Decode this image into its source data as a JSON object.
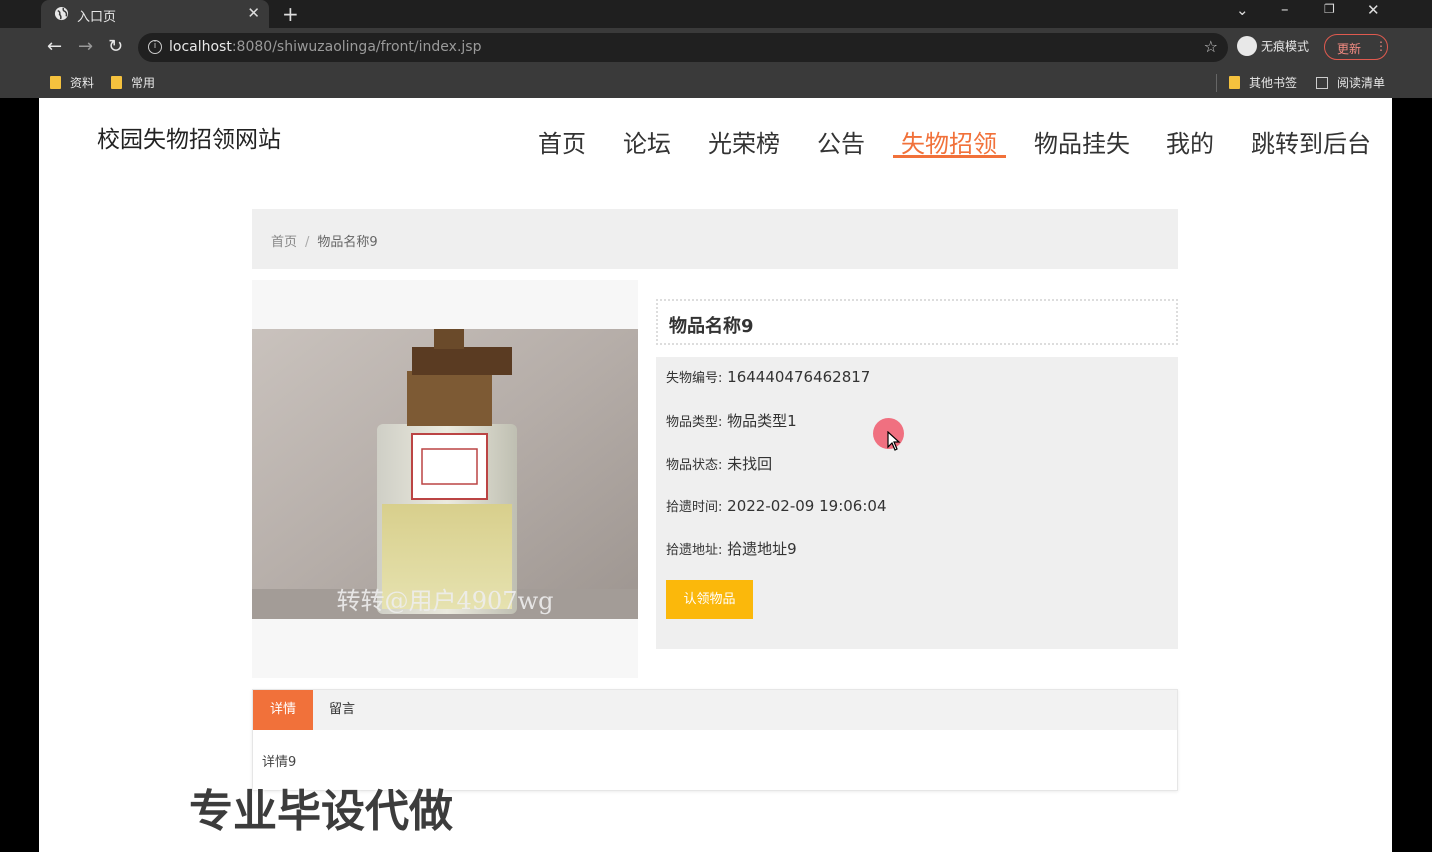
{
  "browser": {
    "tab_title": "入口页",
    "tab_close": "✕",
    "new_tab": "+",
    "url_host": "localhost",
    "url_rest": ":8080/shiwuzaolinga/front/index.jsp",
    "incognito_label": "无痕模式",
    "update_label": "更新",
    "bookmarks": [
      "资料",
      "常用"
    ],
    "other_bookmarks": "其他书签",
    "reading_list": "阅读清单"
  },
  "site": {
    "title": "校园失物招领网站",
    "nav": [
      "首页",
      "论坛",
      "光荣榜",
      "公告",
      "失物招领",
      "物品挂失",
      "我的",
      "跳转到后台"
    ],
    "active_nav": "失物招领"
  },
  "breadcrumb": {
    "home": "首页",
    "separator": "/",
    "current": "物品名称9"
  },
  "item": {
    "name": "物品名称9",
    "photo_caption": "转转@用户4907wg",
    "fields": [
      {
        "label": "失物编号:",
        "value": "164440476462817"
      },
      {
        "label": "物品类型:",
        "value": "物品类型1"
      },
      {
        "label": "物品状态:",
        "value": "未找回"
      },
      {
        "label": "拾遗时间:",
        "value": "2022-02-09 19:06:04"
      },
      {
        "label": "拾遗地址:",
        "value": "拾遗地址9"
      }
    ],
    "claim_button": "认领物品"
  },
  "tabs": {
    "details": "详情",
    "comments": "留言",
    "details_content": "详情9"
  },
  "overlay": {
    "watermark": "专业毕设代做"
  },
  "colors": {
    "accent": "#f1713a",
    "claim": "#fbb80b"
  }
}
